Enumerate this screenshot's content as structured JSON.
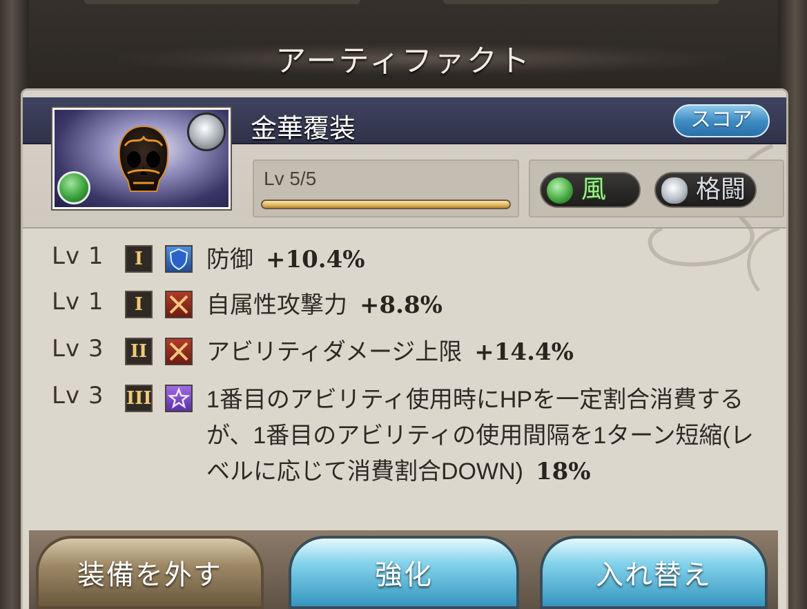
{
  "header": {
    "title": "アーティファクト"
  },
  "artifact": {
    "name": "金華覆装",
    "score_label": "スコア",
    "level_text": "Lv 5/5",
    "level_progress": 1.0,
    "element_label": "風",
    "weapon_label": "格闘",
    "element_icon": "wind-icon",
    "weapon_icon": "fist-icon",
    "image_icon": "skull-mask-icon"
  },
  "skills": [
    {
      "level": "Lv 1",
      "tier": "I",
      "icon": "shield-icon",
      "text": "防御",
      "value": "+10.4%"
    },
    {
      "level": "Lv 1",
      "tier": "I",
      "icon": "crossed-swords-icon",
      "text": "自属性攻撃力",
      "value": "+8.8%"
    },
    {
      "level": "Lv 3",
      "tier": "II",
      "icon": "crossed-swords-icon",
      "text": "アビリティダメージ上限",
      "value": "+14.4%"
    },
    {
      "level": "Lv 3",
      "tier": "III",
      "icon": "star-icon",
      "text": "1番目のアビリティ使用時にHPを一定割合消費するが、1番目のアビリティの使用間隔を1ターン短縮(レベルに応じて消費割合DOWN)",
      "value": "18%"
    }
  ],
  "buttons": {
    "unequip": "装備を外す",
    "upgrade": "強化",
    "swap": "入れ替え"
  },
  "colors": {
    "panel_bg": "#dcd7cd",
    "name_bar": "#3e4360",
    "accent_blue": "#3f8ec4",
    "wind_green": "#3aa13a"
  }
}
